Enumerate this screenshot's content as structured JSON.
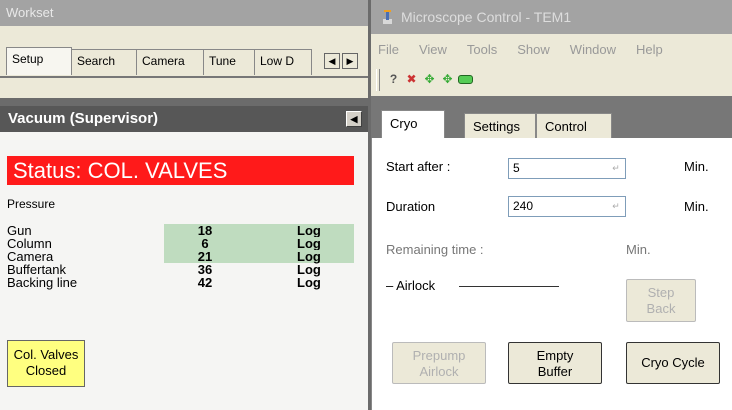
{
  "workset": {
    "title": "Workset",
    "tabs": [
      "Setup",
      "Search",
      "Camera",
      "Tune",
      "Low D"
    ],
    "scroll_left": "◀",
    "scroll_right": "▶"
  },
  "vacuum": {
    "title": "Vacuum (Supervisor)",
    "collapse": "◀",
    "status": "Status:  COL. VALVES",
    "pressure_label": "Pressure",
    "rows": [
      {
        "name": "Gun",
        "value": "18",
        "unit": "Log",
        "highlight": true
      },
      {
        "name": "Column",
        "value": "6",
        "unit": "Log",
        "highlight": true
      },
      {
        "name": "Camera",
        "value": "21",
        "unit": "Log",
        "highlight": true
      },
      {
        "name": "Buffertank",
        "value": "36",
        "unit": "Log",
        "highlight": false
      },
      {
        "name": "Backing line",
        "value": "42",
        "unit": "Log",
        "highlight": false
      }
    ],
    "valves_line1": "Col. Valves",
    "valves_line2": "Closed"
  },
  "microscope": {
    "title": "Microscope Control - TEM1",
    "menu": [
      "File",
      "View",
      "Tools",
      "Show",
      "Window",
      "Help"
    ],
    "tabs": [
      "Cryo",
      "Settings",
      "Control"
    ],
    "start_after_label": "Start after :",
    "start_after_value": "5",
    "start_after_unit": "Min.",
    "duration_label": "Duration",
    "duration_value": "240",
    "duration_unit": "Min.",
    "remaining_label": "Remaining time :",
    "remaining_unit": "Min.",
    "airlock_label": "Airlock",
    "step_back_line1": "Step",
    "step_back_line2": "Back",
    "prepump_line1": "Prepump",
    "prepump_line2": "Airlock",
    "empty_buffer_line1": "Empty",
    "empty_buffer_line2": "Buffer",
    "cryo_cycle": "Cryo Cycle",
    "spin_glyph": "↵"
  }
}
